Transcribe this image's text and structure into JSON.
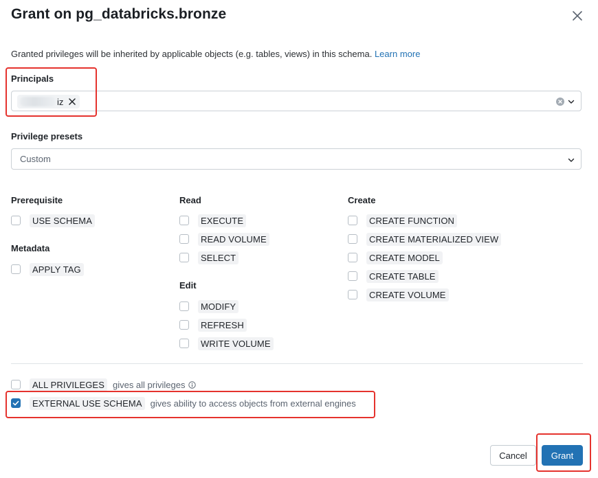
{
  "dialog": {
    "title": "Grant on pg_databricks.bronze",
    "description": "Granted privileges will be inherited by applicable objects (e.g. tables, views) in this schema.",
    "learn_more": "Learn more"
  },
  "principals": {
    "label": "Principals",
    "chip_text": "iz"
  },
  "presets": {
    "label": "Privilege presets",
    "value": "Custom"
  },
  "groups": {
    "prerequisite": {
      "title": "Prerequisite",
      "items": [
        {
          "label": "USE SCHEMA",
          "checked": false
        }
      ]
    },
    "metadata": {
      "title": "Metadata",
      "items": [
        {
          "label": "APPLY TAG",
          "checked": false
        }
      ]
    },
    "read": {
      "title": "Read",
      "items": [
        {
          "label": "EXECUTE",
          "checked": false
        },
        {
          "label": "READ VOLUME",
          "checked": false
        },
        {
          "label": "SELECT",
          "checked": false
        }
      ]
    },
    "edit": {
      "title": "Edit",
      "items": [
        {
          "label": "MODIFY",
          "checked": false
        },
        {
          "label": "REFRESH",
          "checked": false
        },
        {
          "label": "WRITE VOLUME",
          "checked": false
        }
      ]
    },
    "create": {
      "title": "Create",
      "items": [
        {
          "label": "CREATE FUNCTION",
          "checked": false
        },
        {
          "label": "CREATE MATERIALIZED VIEW",
          "checked": false
        },
        {
          "label": "CREATE MODEL",
          "checked": false
        },
        {
          "label": "CREATE TABLE",
          "checked": false
        },
        {
          "label": "CREATE VOLUME",
          "checked": false
        }
      ]
    }
  },
  "special": {
    "all_privileges": {
      "label": "ALL PRIVILEGES",
      "hint": "gives all privileges",
      "checked": false
    },
    "external_use": {
      "label": "EXTERNAL USE SCHEMA",
      "hint": "gives ability to access objects from external engines",
      "checked": true
    }
  },
  "footer": {
    "cancel": "Cancel",
    "grant": "Grant"
  },
  "colors": {
    "accent": "#2272b4",
    "highlight": "#e5322d"
  },
  "icons": [
    "close-icon",
    "remove-chip-icon",
    "clear-icon",
    "chevron-down-icon",
    "checkmark-icon",
    "info-icon"
  ]
}
